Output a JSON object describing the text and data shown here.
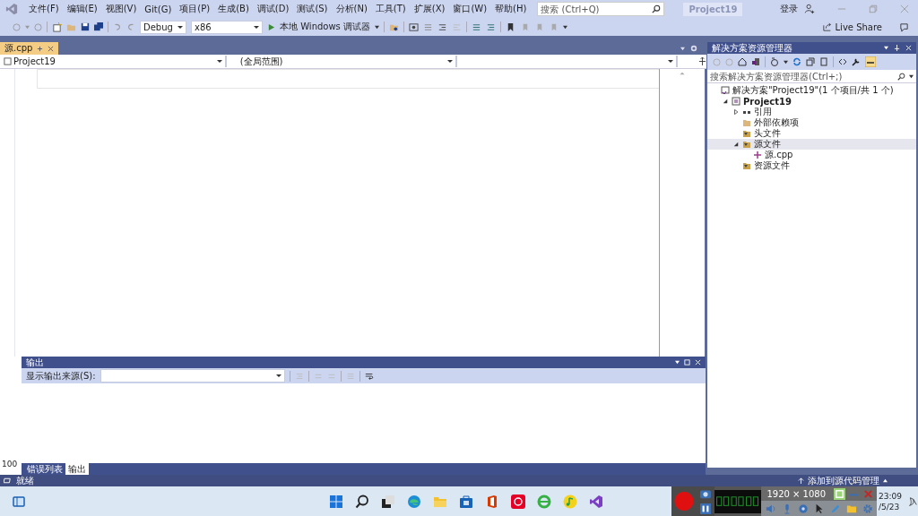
{
  "menu": [
    "文件(F)",
    "编辑(E)",
    "视图(V)",
    "Git(G)",
    "项目(P)",
    "生成(B)",
    "调试(D)",
    "测试(S)",
    "分析(N)",
    "工具(T)",
    "扩展(X)",
    "窗口(W)",
    "帮助(H)"
  ],
  "search": {
    "placeholder": "搜索 (Ctrl+Q)"
  },
  "window": {
    "title": "Project19",
    "account": "登录"
  },
  "toolbar": {
    "configuration": "Debug",
    "platform": "x86",
    "run": "本地 Windows 调试器",
    "live_share": "Live Share"
  },
  "editor": {
    "tabs": [
      {
        "label": "源.cpp",
        "selected": true
      }
    ],
    "nav": [
      "Project19",
      "(全局范围)"
    ],
    "zoom": "100"
  },
  "output": {
    "title": "输出",
    "source_label": "显示输出来源(S):"
  },
  "bottom_tabs": [
    {
      "label": "错误列表",
      "selected": false
    },
    {
      "label": "输出",
      "selected": true
    }
  ],
  "solution_explorer": {
    "title": "解决方案资源管理器",
    "search": {
      "placeholder": "搜索解决方案资源管理器(Ctrl+;)"
    },
    "tree": [
      {
        "label": "解决方案\"Project19\"(1 个项目/共 1 个)",
        "kind": "solution",
        "selected": false,
        "children": [
          {
            "label": "Project19",
            "kind": "project",
            "expanded": true,
            "selected": false,
            "children": [
              {
                "label": "引用",
                "kind": "references",
                "expanded": false,
                "selected": false
              },
              {
                "label": "外部依赖项",
                "kind": "folder",
                "selected": false
              },
              {
                "label": "头文件",
                "kind": "filter",
                "selected": false
              },
              {
                "label": "源文件",
                "kind": "filter",
                "expanded": true,
                "selected": true,
                "children": [
                  {
                    "label": "源.cpp",
                    "kind": "file",
                    "selected": false
                  }
                ]
              },
              {
                "label": "资源文件",
                "kind": "filter",
                "selected": false
              }
            ]
          }
        ]
      }
    ]
  },
  "status_bar": {
    "text": "就绪",
    "source_control": "添加到源代码管理"
  },
  "recorder": {
    "resolution": "1920 × 1080"
  },
  "clock": {
    "time": "23:09",
    "date": "/5/23"
  }
}
